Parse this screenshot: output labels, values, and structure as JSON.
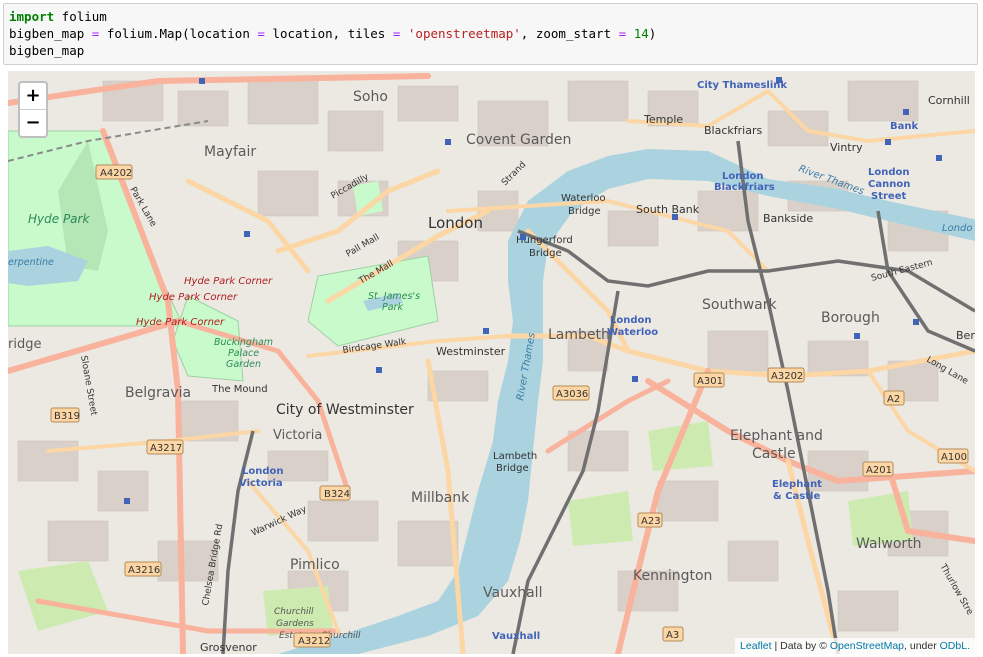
{
  "code": {
    "line1": {
      "kw": "import",
      "rest": " folium"
    },
    "line2": {
      "a": "bigben_map ",
      "eq1": "=",
      "b": " folium.Map(location ",
      "eq2": "=",
      "c": " location, tiles ",
      "eq3": "=",
      "d": " ",
      "str": "'openstreetmap'",
      "e": ", zoom_start ",
      "eq4": "=",
      "f": " ",
      "num": "14",
      "g": ")"
    },
    "line3": "bigben_map"
  },
  "map": {
    "zoom_in": "+",
    "zoom_out": "−",
    "attribution": {
      "leaflet": "Leaflet",
      "sep": " | Data by © ",
      "osm": "OpenStreetMap",
      "under": ", under ",
      "odbl": "ODbL."
    },
    "labels": {
      "soho": "Soho",
      "covent_garden": "Covent Garden",
      "mayfair": "Mayfair",
      "london": "London",
      "temple": "Temple",
      "blackfriars": "Blackfriars",
      "cornhill": "Cornhill",
      "vintry": "Vintry",
      "bank": "Bank",
      "city_thameslink": "City Thameslink",
      "hyde_park": "Hyde Park",
      "hyde_park_corner_1": "Hyde Park Corner",
      "hyde_park_corner_2": "Hyde Park Corner",
      "hyde_park_corner_3": "Hyde Park Corner",
      "st_james_park_1": "St. James's",
      "st_james_park_2": "Park",
      "buckingham_1": "Buckingham",
      "buckingham_2": "Palace",
      "buckingham_3": "Garden",
      "westminster": "Westminster",
      "city_of_westminster": "City of Westminster",
      "victoria": "Victoria",
      "london_victoria_1": "London",
      "london_victoria_2": "Victoria",
      "belgravia": "Belgravia",
      "the_mound": "The Mound",
      "millbank": "Millbank",
      "pimlico": "Pimlico",
      "vauxhall": "Vauxhall",
      "vauxhall_station": "Vauxhall",
      "kennington": "Kennington",
      "walworth": "Walworth",
      "elephant_1": "Elephant and",
      "elephant_2": "Castle",
      "elephant_station_1": "Elephant",
      "elephant_station_2": "& Castle",
      "lambeth": "Lambeth",
      "lambeth_bridge_1": "Lambeth",
      "lambeth_bridge_2": "Bridge",
      "london_waterloo_1": "London",
      "london_waterloo_2": "Waterloo",
      "southwark": "Southwark",
      "borough": "Borough",
      "south_bank": "South Bank",
      "bankside": "Bankside",
      "waterloo_bridge_1": "Waterloo",
      "waterloo_bridge_2": "Bridge",
      "hungerford_1": "Hungerford",
      "hungerford_2": "Bridge",
      "london_blackfriars_1": "London",
      "london_blackfriars_2": "Blackfriars",
      "london_cannon_1": "London",
      "london_cannon_2": "Cannon",
      "london_cannon_3": "Street",
      "river_thames_1": "River Thames",
      "river_thames_2": "River Thames",
      "piccadilly": "Piccadilly",
      "pall_mall": "Pall Mall",
      "the_mall": "The Mall",
      "birdcage_walk": "Birdcage Walk",
      "strand": "Strand",
      "park_lane": "Park Lane",
      "sloane_street": "Sloane Street",
      "warwick_way": "Warwick Way",
      "chelsea_bridge_rd": "Chelsea Bridge Rd",
      "long_lane": "Long Lane",
      "churchill_1": "Churchill",
      "churchill_2": "Gardens",
      "churchill_3": "Estate",
      "grosvenor": "Grosvenor",
      "serpentine": "erpentine",
      "bridge_left": "ridge",
      "ber": "Ber",
      "london_right": "Londo",
      "southeastern": "South Eastern",
      "thurlow": "Thurlow Stre"
    },
    "road_shields": {
      "a4202": "A4202",
      "b319": "B319",
      "a3217": "A3217",
      "b324": "B324",
      "a3216": "A3216",
      "a3212": "A3212",
      "a3036": "A3036",
      "a301": "A301",
      "a3202": "A3202",
      "a2": "A2",
      "a201": "A201",
      "a100": "A100",
      "a23": "A23",
      "a3": "A3"
    },
    "colors": {
      "water": "#aad3df",
      "park": "#c8facc",
      "grass": "#cdebb0",
      "motorway": "#fcd6a4",
      "primary": "#f9b29c",
      "rail": "#707070",
      "land": "#f2efe9",
      "station": "#4264b8",
      "place": "#5a5a5a"
    }
  }
}
